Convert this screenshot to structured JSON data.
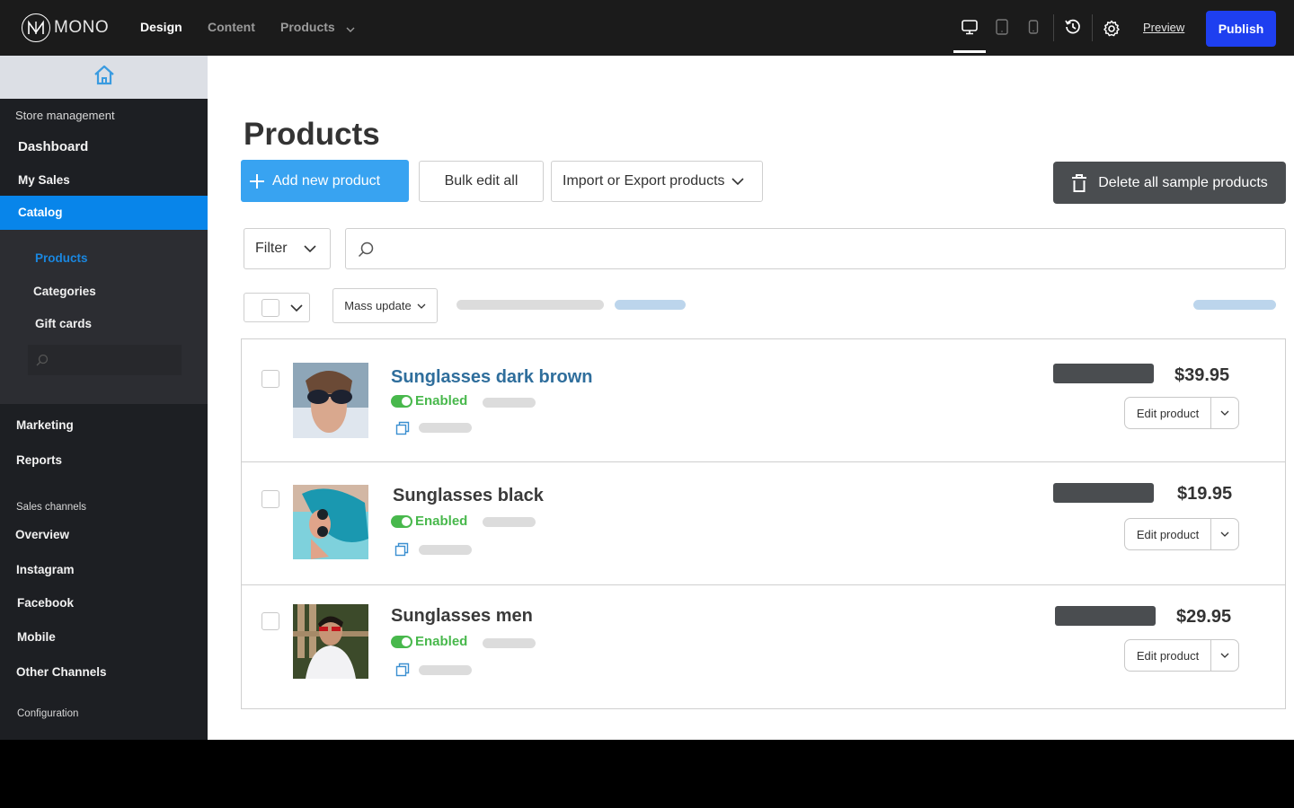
{
  "topbar": {
    "logo_text": "MONO",
    "nav": [
      {
        "label": "Design",
        "active": true
      },
      {
        "label": "Content",
        "active": false
      },
      {
        "label": "Products",
        "active": false,
        "has_dropdown": true
      }
    ],
    "device_icons": [
      "desktop-icon",
      "tablet-icon",
      "mobile-icon"
    ],
    "active_device": "desktop",
    "history_icon": "history-icon",
    "settings_icon": "gear-icon",
    "preview_label": "Preview",
    "publish_label": "Publish",
    "publish_color": "#1e3ff0"
  },
  "sidebar": {
    "home_icon": "home-icon",
    "store_management_label": "Store management",
    "items_top": [
      "Dashboard",
      "My Sales"
    ],
    "catalog_label": "Catalog",
    "catalog_color": "#0885ea",
    "catalog_sub": [
      {
        "label": "Products",
        "active": true
      },
      {
        "label": "Categories",
        "active": false
      },
      {
        "label": "Gift cards",
        "active": false
      }
    ],
    "search_placeholder": "",
    "items_mid": [
      "Marketing",
      "Reports"
    ],
    "sales_channels_label": "Sales channels",
    "channels": [
      "Overview",
      "Instagram",
      "Facebook",
      "Mobile",
      "Other Channels"
    ],
    "configuration_label": "Configuration"
  },
  "main": {
    "title": "Products",
    "add_button": "Add new product",
    "bulk_edit_button": "Bulk edit all",
    "import_export_button": "Import or Export products",
    "delete_samples_button": "Delete all sample products",
    "filter_label": "Filter",
    "search_value": "",
    "search_placeholder": "",
    "mass_update_label": "Mass update",
    "products": [
      {
        "name": "Sunglasses dark brown",
        "status": "Enabled",
        "price": "$39.95",
        "edit_label": "Edit product",
        "name_is_link": true
      },
      {
        "name": "Sunglasses black",
        "status": "Enabled",
        "price": "$19.95",
        "edit_label": "Edit product",
        "name_is_link": false
      },
      {
        "name": "Sunglasses men",
        "status": "Enabled",
        "price": "$29.95",
        "edit_label": "Edit product",
        "name_is_link": false
      }
    ]
  }
}
